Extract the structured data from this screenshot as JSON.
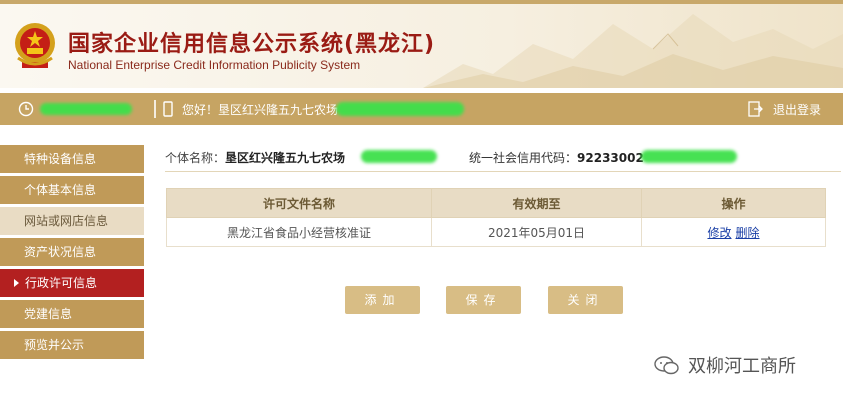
{
  "header": {
    "title_cn": "国家企业信用信息公示系统(黑龙江)",
    "title_en": "National Enterprise Credit Information Publicity System",
    "brand_color": "#9a1b14"
  },
  "infobar": {
    "greeting": "您好！垦区红兴隆五九七农场",
    "logout": "退出登录"
  },
  "sidebar": {
    "items": [
      {
        "label": "特种设备信息",
        "state": "normal"
      },
      {
        "label": "个体基本信息",
        "state": "normal"
      },
      {
        "label": "网站或网店信息",
        "state": "dim"
      },
      {
        "label": "资产状况信息",
        "state": "normal"
      },
      {
        "label": "行政许可信息",
        "state": "active"
      },
      {
        "label": "党建信息",
        "state": "normal"
      },
      {
        "label": "预览并公示",
        "state": "normal"
      }
    ]
  },
  "main": {
    "name_label": "个体名称：",
    "name_value": "垦区红兴隆五九七农场",
    "code_label": "统一社会信用代码：",
    "code_value": "92233002"
  },
  "table": {
    "headers": [
      "许可文件名称",
      "有效期至",
      "操作"
    ],
    "rows": [
      {
        "name": "黑龙江省食品小经营核准证",
        "expiry": "2021年05月01日",
        "edit": "修改",
        "delete": "删除"
      }
    ]
  },
  "buttons": {
    "add": "添加",
    "save": "保存",
    "close": "关闭"
  },
  "watermark": {
    "text": "双柳河工商所"
  },
  "colors": {
    "accent_gold": "#c6a463",
    "active_red": "#b32020",
    "button_gold": "#d8bd85"
  }
}
